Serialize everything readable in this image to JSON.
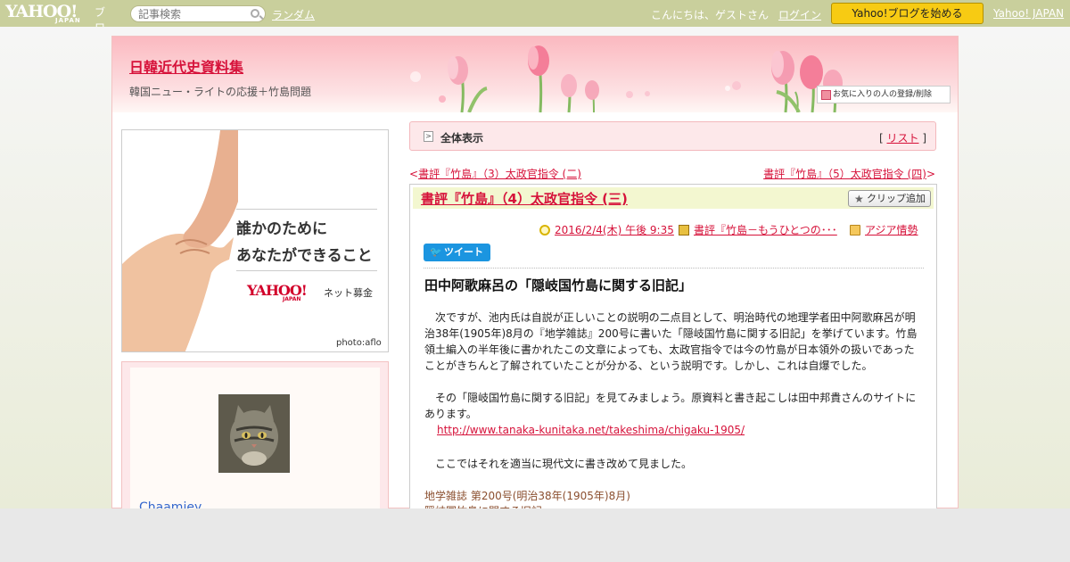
{
  "topbar": {
    "logo_text": "YAHOO!",
    "logo_japan": "JAPAN",
    "logo_blog": "ブログ",
    "search_placeholder": "記事検索",
    "random_label": "ランダム",
    "greeting": "こんにちは、ゲストさん",
    "login_label": "ログイン",
    "start_label": "Yahoo!ブログを始める",
    "yahoo_japan_label": "Yahoo! JAPAN"
  },
  "header": {
    "blog_title": "日韓近代史資料集",
    "blog_desc": "韓国ニュー・ライトの応援＋竹島問題",
    "fav_label": "お気に入りの人の登録/削除"
  },
  "ad": {
    "line1": "誰かのために",
    "line2": "あなたができること",
    "brand": "YAHOO!",
    "brand_sub": "JAPAN",
    "service": "ネット募金",
    "credit": "photo:aflo"
  },
  "profile": {
    "nickname": "Chaamiey"
  },
  "allview": {
    "label": "全体表示",
    "list_prefix": "[ ",
    "list_label": "リスト",
    "list_suffix": " ]"
  },
  "nav": {
    "prev_mark": "<",
    "prev_title": "書評『竹島』（3）太政官指令 (二)",
    "next_title": "書評『竹島』（5）太政官指令 (四)",
    "next_mark": ">"
  },
  "article": {
    "title": "書評『竹島』（4）太政官指令 (三)",
    "clip_label": "クリップ追加",
    "date": "2016/2/4(木) 午後 9:35",
    "book": "書評『竹島－もうひとつの･･･",
    "category": "アジア情勢",
    "tweet_label": "ツイート",
    "heading": "田中阿歌麻呂の「隠岐国竹島に関する旧記」",
    "para1": "　次ですが、池内氏は自説が正しいことの説明の二点目として、明治時代の地理学者田中阿歌麻呂が明治38年(1905年)8月の『地学雑誌』200号に書いた「隠岐国竹島に関する旧記」を挙げています。竹島領土編入の半年後に書かれたこの文章によっても、太政官指令では今の竹島が日本領外の扱いであったことがきちんと了解されていたことが分かる、という説明です。しかし、これは自爆でした。",
    "para2": "　その「隠岐国竹島に関する旧記」を見てみましょう。原資料と書き起こしは田中邦貴さんのサイトにあります。",
    "link": "http://www.tanaka-kunitaka.net/takeshima/chigaku-1905/",
    "para3": "　ここではそれを適当に現代文に書き改めて見ました。",
    "source1": "地学雑誌 第200号(明治38年(1905年)8月)",
    "source2": "隠岐国竹島に関する旧記"
  }
}
